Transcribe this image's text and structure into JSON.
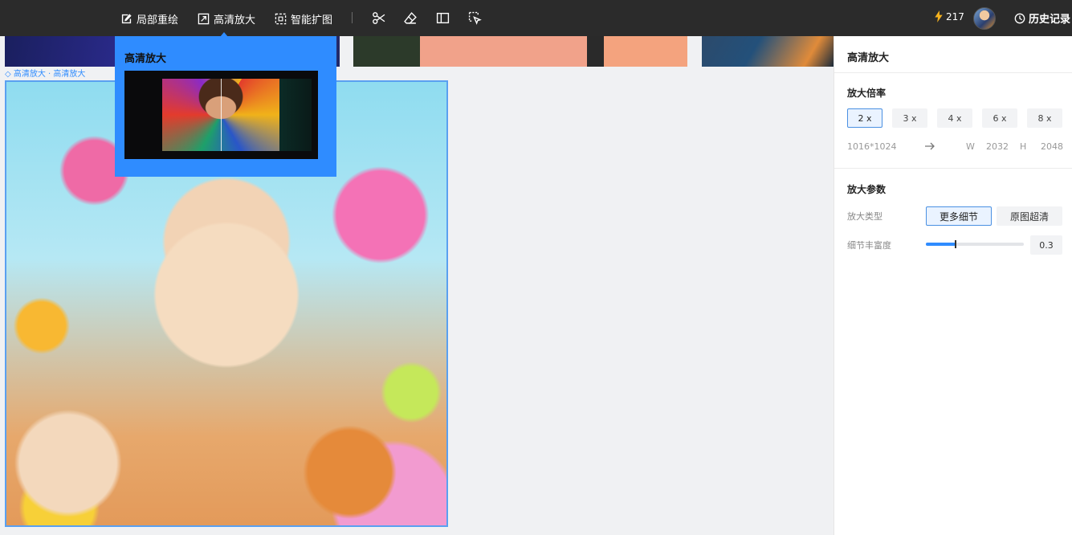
{
  "toolbar": {
    "local_redraw": "局部重绘",
    "hd_upscale": "高清放大",
    "smart_expand": "智能扩图",
    "credits": "217",
    "history": "历史记录"
  },
  "breadcrumb": "◇ 高清放大 · 高清放大",
  "popover": {
    "title": "高清放大"
  },
  "panel": {
    "title": "高清放大",
    "scale_section": "放大倍率",
    "scales": [
      "2 x",
      "3 x",
      "4 x",
      "6 x",
      "8 x"
    ],
    "selected_scale": "2 x",
    "source_size": "1016*1024",
    "w_label": "W",
    "w_value": "2032",
    "h_label": "H",
    "h_value": "2048",
    "params_section": "放大参数",
    "type_label": "放大类型",
    "type_option_more_detail": "更多细节",
    "type_option_original_hd": "原图超清",
    "detail_label": "细节丰富度",
    "detail_value": "0.3"
  },
  "colors": {
    "toolbar_bg": "#2b2b2b",
    "accent": "#2f8cff",
    "panel_bg": "#ffffff",
    "canvas_bg": "#f0f1f3"
  }
}
